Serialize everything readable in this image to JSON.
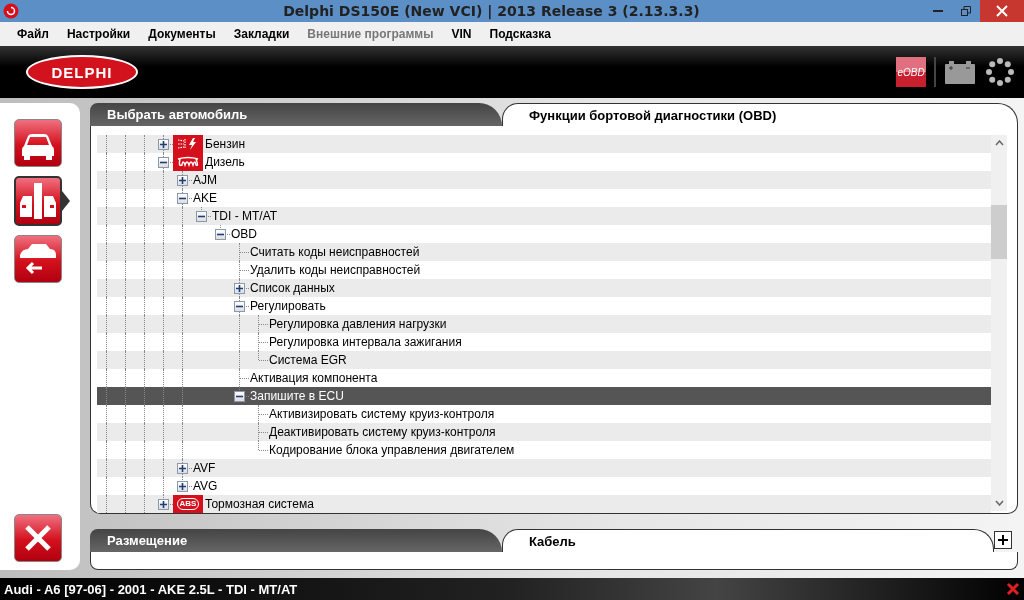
{
  "window": {
    "title": "Delphi DS150E (New VCI) | 2013 Release 3 (2.13.3.3)"
  },
  "menu": [
    {
      "label": "Файл",
      "disabled": false
    },
    {
      "label": "Настройки",
      "disabled": false
    },
    {
      "label": "Документы",
      "disabled": false
    },
    {
      "label": "Закладки",
      "disabled": false
    },
    {
      "label": "Внешние программы",
      "disabled": true
    },
    {
      "label": "VIN",
      "disabled": false
    },
    {
      "label": "Подсказка",
      "disabled": false
    }
  ],
  "header": {
    "logo": "DELPHI",
    "badge": "eOBD"
  },
  "sidebar": {
    "items": [
      {
        "kind": "car",
        "selected": false
      },
      {
        "kind": "cars",
        "selected": true
      },
      {
        "kind": "car-back",
        "selected": false
      }
    ]
  },
  "tabs": [
    {
      "label": "Выбрать автомобиль",
      "selected": false
    },
    {
      "label": "Функции бортовой диагностики (OBD)",
      "selected": true
    }
  ],
  "tree": [
    {
      "label": "Бензин",
      "kind": "fuel",
      "expanded": false,
      "selected": false
    },
    {
      "label": "Дизель",
      "kind": "glow",
      "expanded": true,
      "selected": false,
      "children": [
        {
          "label": "AJM",
          "kind": "branch",
          "expanded": false,
          "selected": false
        },
        {
          "label": "AKE",
          "kind": "branch",
          "expanded": true,
          "selected": false,
          "children": [
            {
              "label": "TDI - MT/AT",
              "kind": "branch",
              "expanded": true,
              "selected": false,
              "children": [
                {
                  "label": "OBD",
                  "kind": "branch",
                  "expanded": true,
                  "selected": false,
                  "children": [
                    {
                      "label": "Считать коды неисправностей",
                      "kind": "leaf",
                      "selected": false
                    },
                    {
                      "label": "Удалить коды неисправностей",
                      "kind": "leaf",
                      "selected": false
                    },
                    {
                      "label": "Список данных",
                      "kind": "branch",
                      "expanded": false,
                      "selected": false
                    },
                    {
                      "label": "Регулировать",
                      "kind": "branch",
                      "expanded": true,
                      "selected": false,
                      "children": [
                        {
                          "label": "Регулировка давления нагрузки",
                          "kind": "leaf",
                          "selected": false
                        },
                        {
                          "label": "Регулировка интервала зажигания",
                          "kind": "leaf",
                          "selected": false
                        },
                        {
                          "label": "Система EGR",
                          "kind": "leaf",
                          "selected": false
                        }
                      ]
                    },
                    {
                      "label": "Активация компонента",
                      "kind": "leaf",
                      "selected": false
                    },
                    {
                      "label": "Запишите в ECU",
                      "kind": "branch",
                      "expanded": true,
                      "selected": true,
                      "children": [
                        {
                          "label": "Активизировать систему круиз-контроля",
                          "kind": "leaf",
                          "selected": false
                        },
                        {
                          "label": "Деактивировать систему круиз-контроля",
                          "kind": "leaf",
                          "selected": false
                        },
                        {
                          "label": "Кодирование блока управления двигателем",
                          "kind": "leaf",
                          "selected": false
                        }
                      ]
                    }
                  ]
                }
              ]
            }
          ]
        },
        {
          "label": "AVF",
          "kind": "branch",
          "expanded": false,
          "selected": false
        },
        {
          "label": "AVG",
          "kind": "branch",
          "expanded": false,
          "selected": false
        }
      ]
    },
    {
      "label": "Тормозная система",
      "kind": "abs",
      "icon_text": "ABS",
      "expanded": false,
      "selected": false
    }
  ],
  "bottom_tabs": [
    {
      "label": "Размещение",
      "selected": false
    },
    {
      "label": "Кабель",
      "selected": true
    }
  ],
  "status_bar": {
    "text": "Audi - A6 [97-06] - 2001 - AKE 2.5L - TDI - MT/AT"
  }
}
